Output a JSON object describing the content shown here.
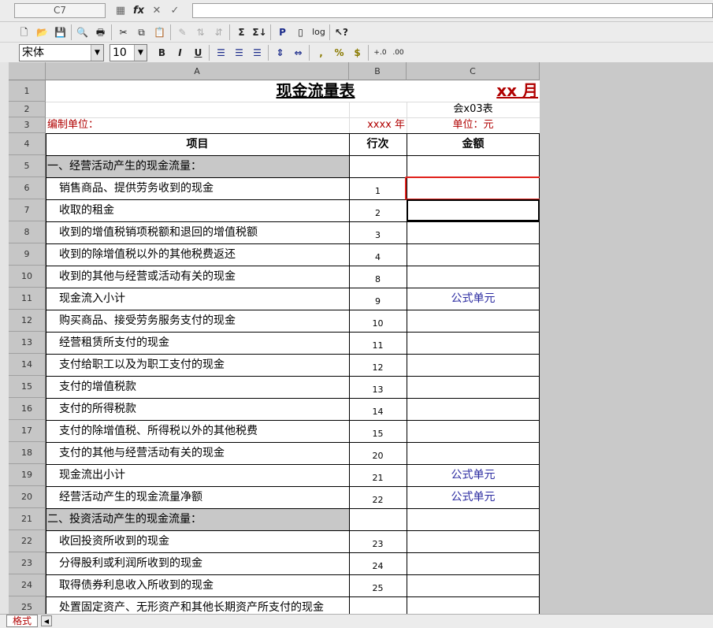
{
  "formula_bar": {
    "cell_ref": "C7",
    "function_icon": "fx"
  },
  "format_toolbar": {
    "font_name": "宋体",
    "font_size": "10"
  },
  "columns": [
    {
      "letter": "A"
    },
    {
      "letter": "B"
    },
    {
      "letter": "C"
    }
  ],
  "sheet": {
    "title": "现金流量表",
    "month": "xx  月",
    "form_code": "会x03表",
    "company_label": "编制单位：",
    "year_label": "xxxx  年",
    "unit_label": "单位：元",
    "headers": {
      "item": "项目",
      "line_no": "行次",
      "amount": "金额"
    },
    "rows": [
      {
        "num": "1"
      },
      {
        "num": "2"
      },
      {
        "num": "3"
      },
      {
        "num": "4",
        "a": "",
        "b": "",
        "c": ""
      },
      {
        "num": "5",
        "a": "一、经营活动产生的现金流量：",
        "b": "",
        "c": "",
        "section": true
      },
      {
        "num": "6",
        "a": "销售商品、提供劳务收到的现金",
        "b": "1",
        "c": ""
      },
      {
        "num": "7",
        "a": "收取的租金",
        "b": "2",
        "c": ""
      },
      {
        "num": "8",
        "a": "收到的增值税销项税额和退回的增值税额",
        "b": "3",
        "c": ""
      },
      {
        "num": "9",
        "a": "收到的除增值税以外的其他税费返还",
        "b": "4",
        "c": ""
      },
      {
        "num": "10",
        "a": "收到的其他与经营或活动有关的现金",
        "b": "8",
        "c": ""
      },
      {
        "num": "11",
        "a": "现金流入小计",
        "b": "9",
        "c": "公式单元"
      },
      {
        "num": "12",
        "a": "购买商品、接受劳务服务支付的现金",
        "b": "10",
        "c": ""
      },
      {
        "num": "13",
        "a": "经营租赁所支付的现金",
        "b": "11",
        "c": ""
      },
      {
        "num": "14",
        "a": "支付给职工以及为职工支付的现金",
        "b": "12",
        "c": ""
      },
      {
        "num": "15",
        "a": "支付的增值税款",
        "b": "13",
        "c": ""
      },
      {
        "num": "16",
        "a": "支付的所得税款",
        "b": "14",
        "c": ""
      },
      {
        "num": "17",
        "a": "支付的除增值税、所得税以外的其他税费",
        "b": "15",
        "c": ""
      },
      {
        "num": "18",
        "a": "支付的其他与经营活动有关的现金",
        "b": "20",
        "c": ""
      },
      {
        "num": "19",
        "a": "现金流出小计",
        "b": "21",
        "c": "公式单元"
      },
      {
        "num": "20",
        "a": "经营活动产生的现金流量净额",
        "b": "22",
        "c": "公式单元"
      },
      {
        "num": "21",
        "a": "二、投资活动产生的现金流量：",
        "b": "",
        "c": "",
        "section": true
      },
      {
        "num": "22",
        "a": "收回投资所收到的现金",
        "b": "23",
        "c": ""
      },
      {
        "num": "23",
        "a": "分得股利或利润所收到的现金",
        "b": "24",
        "c": ""
      },
      {
        "num": "24",
        "a": "取得债券利息收入所收到的现金",
        "b": "25",
        "c": ""
      },
      {
        "num": "25",
        "a": "处置固定资产、无形资产和其他长期资产所支付的现金",
        "b": "",
        "c": ""
      }
    ]
  },
  "bottom": {
    "sheet_tab": "格式"
  }
}
